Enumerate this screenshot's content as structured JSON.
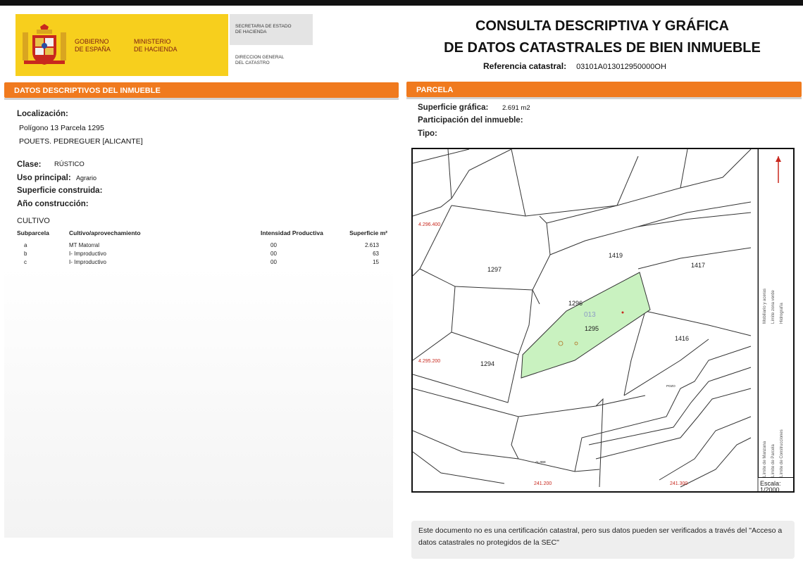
{
  "header": {
    "gov_line1": "GOBIERNO",
    "gov_line2": "DE ESPAÑA",
    "min_line1": "MINISTERIO",
    "min_line2": "DE HACIENDA",
    "sec_line1": "SECRETARIA DE ESTADO",
    "sec_line2": "DE HACIENDA",
    "dir_line1": "DIRECCION GENERAL",
    "dir_line2": "DEL CATASTRO",
    "title_line1": "CONSULTA DESCRIPTIVA Y GRÁFICA",
    "title_line2": "DE DATOS CATASTRALES DE BIEN INMUEBLE",
    "ref_label": "Referencia catastral:",
    "ref_value": "03101A013012950000OH"
  },
  "left": {
    "section_title": "DATOS DESCRIPTIVOS DEL INMUEBLE",
    "localizacion_label": "Localización:",
    "loc_line1": "Polígono 13 Parcela 1295",
    "loc_line2": "POUETS. PEDREGUER [ALICANTE]",
    "clase_label": "Clase:",
    "clase_value": "RÚSTICO",
    "uso_label": "Uso principal:",
    "uso_value": "Agrario",
    "superficie_label": "Superficie construida:",
    "anio_label": "Año construcción:",
    "cultivo_title": "CULTIVO",
    "table_headers": [
      "Subparcela",
      "Cultivo/aprovechamiento",
      "Intensidad Productiva",
      "Superficie m²"
    ],
    "rows": [
      {
        "sub": "a",
        "cultivo": "MT Matorral",
        "intensidad": "00",
        "superficie": "2.613"
      },
      {
        "sub": "b",
        "cultivo": "I- Improductivo",
        "intensidad": "00",
        "superficie": "63"
      },
      {
        "sub": "c",
        "cultivo": "I- Improductivo",
        "intensidad": "00",
        "superficie": "15"
      }
    ]
  },
  "right": {
    "section_title": "PARCELA",
    "sup_grafica_label": "Superficie gráfica:",
    "sup_grafica_value": "2.691 m2",
    "participacion_label": "Participación del inmueble:",
    "tipo_label": "Tipo:",
    "map": {
      "parcel_labels": [
        "1297",
        "1419",
        "1417",
        "1296",
        "1295",
        "1416",
        "1294"
      ],
      "zone_label": "013",
      "coord_labels": [
        "4.296.400",
        "4.295.200",
        "241.200",
        "241.300"
      ],
      "small_labels": [
        "POZO",
        "ALJIBE"
      ],
      "highlight_color": "#c9f2c0"
    },
    "legend": [
      "Límite de Manzana",
      "Límite de Parcela",
      "Límite de Construcciones",
      "Mobiliario y aceras",
      "Límite zona verde",
      "Hidrografía"
    ],
    "scale_label": "Escala:",
    "scale_value": "1/2000",
    "note": "Este documento no es una certificación catastral, pero sus datos pueden ser verificados a través del \"Acceso a datos catastrales no protegidos de la SEC\""
  },
  "colors": {
    "accent": "#f07a1e",
    "logo_yellow": "#f7cf1d",
    "coat_red": "#c8281e"
  }
}
